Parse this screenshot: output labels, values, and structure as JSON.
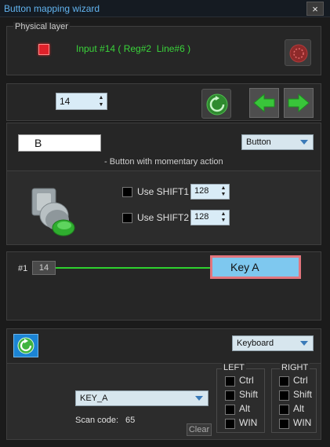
{
  "window": {
    "title": "Button mapping wizard",
    "close_glyph": "×"
  },
  "physical_layer": {
    "group_label": "Physical layer",
    "input_text": "Input #14 ( Reg#2  Line#6 )"
  },
  "nav": {
    "index_value": "14"
  },
  "button_config": {
    "name_value": "B",
    "type_select": "Button",
    "description": "- Button with momentary action",
    "shift1_label": "Use SHIFT1",
    "shift1_value": "128",
    "shift2_label": "Use SHIFT2",
    "shift2_value": "128"
  },
  "mapping": {
    "index_label": "#1",
    "input_number": "14",
    "target_key": "Key A"
  },
  "keyboard": {
    "device_select": "Keyboard",
    "key_select": "KEY_A",
    "scan_code_label": "Scan code:",
    "scan_code_value": "65",
    "clear_label": "Clear",
    "left": {
      "label": "LEFT",
      "mods": [
        "Ctrl",
        "Shift",
        "Alt",
        "WIN"
      ]
    },
    "right": {
      "label": "RIGHT",
      "mods": [
        "Ctrl",
        "Shift",
        "Alt",
        "WIN"
      ]
    }
  },
  "colors": {
    "accent_blue": "#62b4f0",
    "led_red": "#e0212a",
    "active_green": "#3ad43a",
    "key_blue": "#7ec8ef"
  },
  "icons": {
    "close": "close-icon",
    "reset": "reset-icon",
    "refresh": "refresh-icon",
    "prev": "arrow-left-icon",
    "next": "arrow-right-icon"
  }
}
